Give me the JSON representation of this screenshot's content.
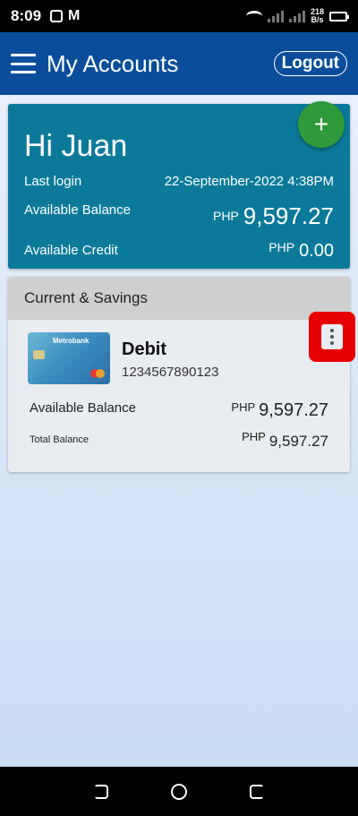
{
  "status_bar": {
    "time": "8:09",
    "mail_glyph": "M",
    "net_speed_value": "218",
    "net_speed_unit": "B/s"
  },
  "app_bar": {
    "title": "My Accounts",
    "logout_label": "Logout"
  },
  "summary": {
    "greeting": "Hi Juan",
    "last_login_label": "Last login",
    "last_login_value": "22-September-2022 4:38PM",
    "available_balance_label": "Available Balance",
    "available_balance_currency": "PHP",
    "available_balance_amount": "9,597.27",
    "available_credit_label": "Available Credit",
    "available_credit_currency": "PHP",
    "available_credit_amount": "0.00",
    "fab_symbol": "+"
  },
  "accounts": {
    "section_title": "Current & Savings",
    "card_brand": "Metrobank",
    "card_type": "Debit",
    "card_number": "1234567890123",
    "available_balance_label": "Available Balance",
    "available_balance_currency": "PHP",
    "available_balance_amount": "9,597.27",
    "total_balance_label": "Total Balance",
    "total_balance_currency": "PHP",
    "total_balance_amount": "9,597.27"
  },
  "colors": {
    "app_bar": "#0a4e9b",
    "summary_card": "#0b7a9a",
    "fab": "#2f9a3a",
    "highlight": "#e60000"
  },
  "icons": {
    "menu": "hamburger-icon",
    "add": "plus-icon",
    "more": "kebab-icon"
  }
}
